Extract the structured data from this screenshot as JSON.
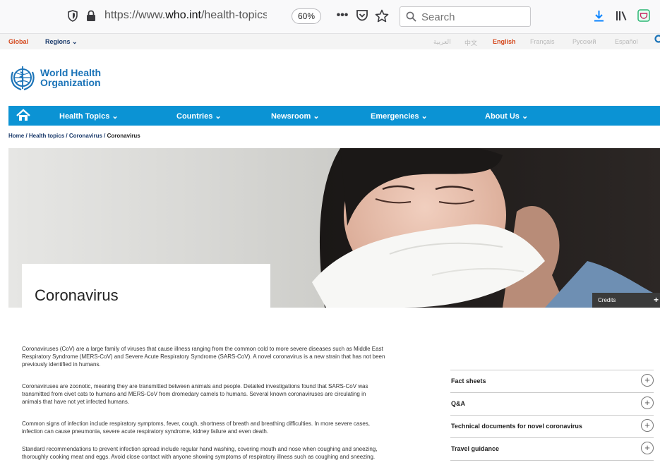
{
  "browser": {
    "url_prefix": "https://www.",
    "url_domain": "who.int",
    "url_path": "/health-topics/co",
    "zoom": "60%",
    "search_placeholder": "Search"
  },
  "topbar": {
    "global": "Global",
    "regions": "Regions",
    "languages": [
      "العربية",
      "中文",
      "English",
      "Français",
      "Русский",
      "Español"
    ],
    "active_language": "English"
  },
  "logo": {
    "line1": "World Health",
    "line2": "Organization"
  },
  "nav": {
    "items": [
      "Health Topics",
      "Countries",
      "Newsroom",
      "Emergencies",
      "About Us"
    ]
  },
  "breadcrumb": [
    "Home",
    "Health topics",
    "Coronavirus",
    "Coronavirus"
  ],
  "hero": {
    "title": "Coronavirus",
    "credits": "Credits"
  },
  "paragraphs": [
    "Coronaviruses (CoV) are a large family of viruses that cause illness ranging from the common cold to more severe diseases such as Middle East Respiratory Syndrome (MERS-CoV) and Severe Acute Respiratory Syndrome (SARS-CoV). A novel coronavirus is a new strain that has not been previously identified in humans.",
    "Coronaviruses are zoonotic, meaning they are transmitted between animals and people.  Detailed investigations found that SARS-CoV was transmitted from civet cats to humans and MERS-CoV from dromedary camels to humans. Several known coronaviruses are circulating in animals that have not yet infected humans.",
    "Common signs of infection include respiratory symptoms, fever, cough, shortness of breath and breathing difficulties. In more severe cases, infection can cause pneumonia, severe acute respiratory syndrome, kidney failure and even death.",
    "Standard recommendations to prevent infection spread include regular hand washing, covering mouth and nose when coughing and sneezing, thoroughly cooking meat and eggs. Avoid close contact with anyone showing symptoms of respiratory illness such as coughing and sneezing."
  ],
  "accordion": [
    "Fact sheets",
    "Q&A",
    "Technical documents for novel coronavirus",
    "Travel guidance"
  ]
}
